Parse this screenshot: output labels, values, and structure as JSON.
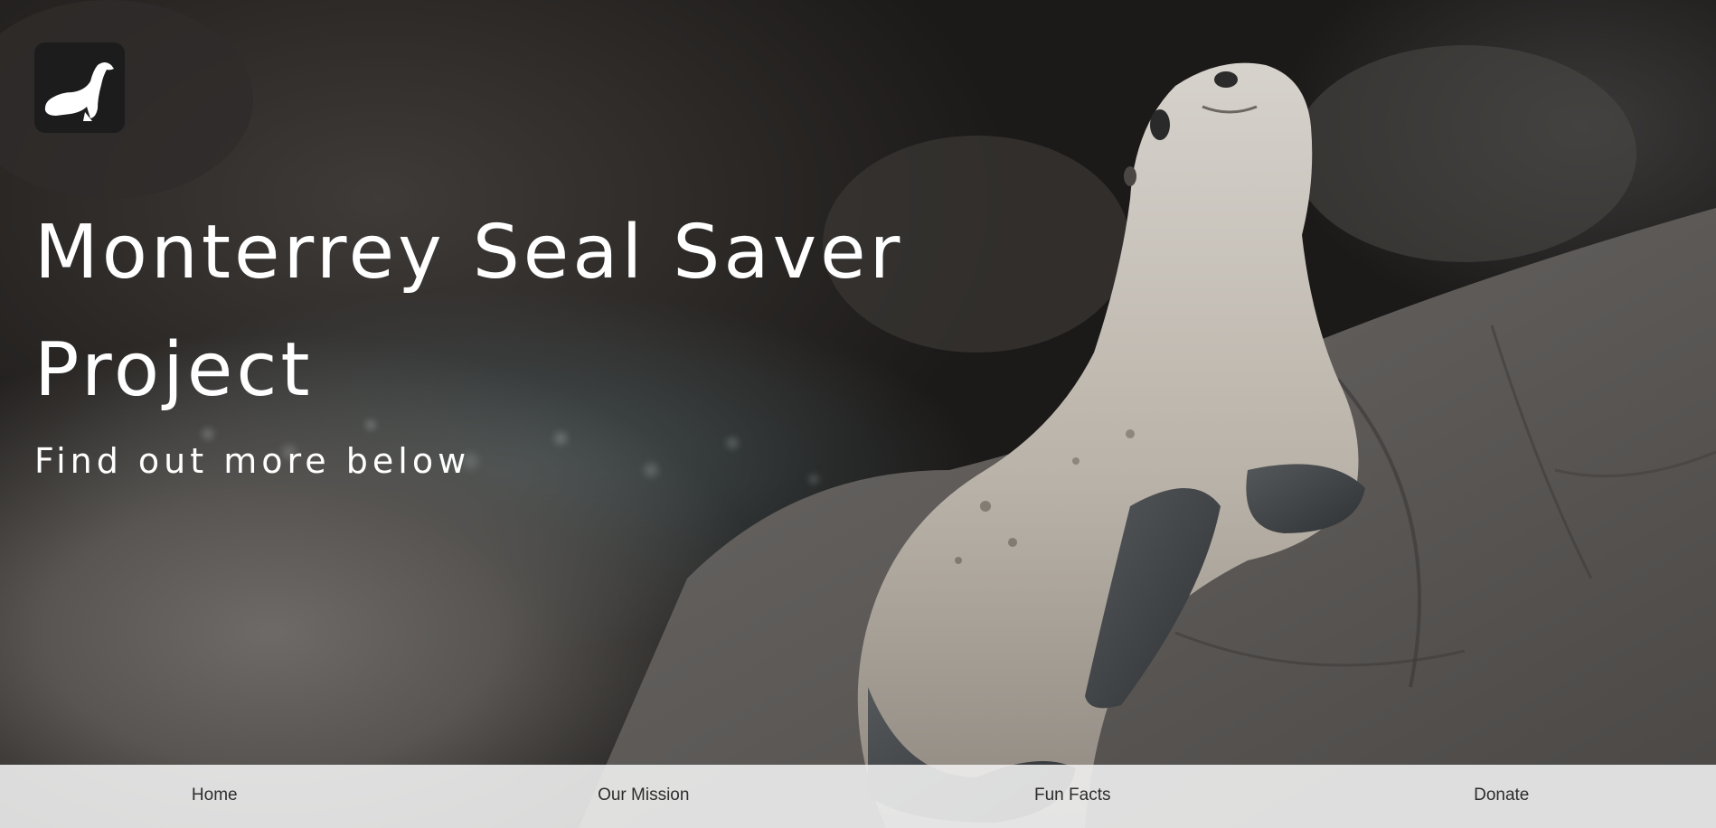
{
  "hero": {
    "title": "Monterrey Seal Saver Project",
    "subtitle": "Find out more below"
  },
  "logo": {
    "icon": "seal-icon",
    "background": "#1d1c1c"
  },
  "nav": {
    "items": [
      {
        "label": "Home"
      },
      {
        "label": "Our Mission"
      },
      {
        "label": "Fun Facts"
      },
      {
        "label": "Donate"
      }
    ]
  },
  "colors": {
    "text_light": "#ffffff",
    "navbar_bg": "#eeeeee",
    "navbar_text": "#2d2d2d"
  }
}
